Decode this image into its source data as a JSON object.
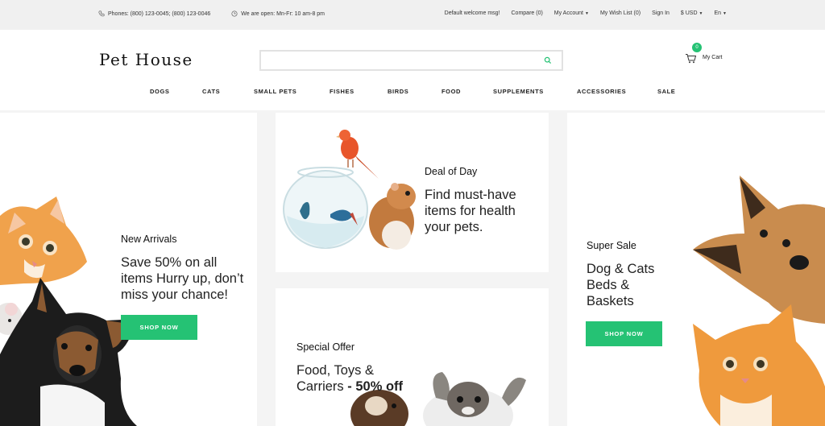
{
  "topbar": {
    "phones": "Phones: (800) 123-0045; (800) 123-0046",
    "hours": "We are open: Mn-Fr: 10 am-8 pm",
    "welcome": "Default welcome msg!",
    "compare": "Compare (0)",
    "my_account": "My Account",
    "wishlist": "My Wish List (0)",
    "sign_in": "Sign In",
    "currency": "$ USD",
    "language": "En"
  },
  "header": {
    "logo": "Pet House",
    "search_placeholder": "",
    "cart_count": "0",
    "cart_label": "My Cart"
  },
  "nav": [
    "DOGS",
    "CATS",
    "SMALL PETS",
    "FISHES",
    "BIRDS",
    "FOOD",
    "SUPPLEMENTS",
    "ACCESSORIES",
    "SALE"
  ],
  "banners": {
    "new_arrivals": {
      "eyebrow": "New Arrivals",
      "headline_1": "Save 50% on all",
      "headline_2": "items Hurry up, don’t",
      "headline_3": "miss your chance!",
      "button": "SHOP NOW"
    },
    "deal": {
      "eyebrow": "Deal of Day",
      "headline_1": "Find must-have",
      "headline_2": "items for health",
      "headline_3": "your pets."
    },
    "special": {
      "eyebrow": "Special Offer",
      "headline_1": "Food, Toys &",
      "headline_2": "Carriers",
      "headline_off": " - 50% off"
    },
    "super_sale": {
      "eyebrow": "Super Sale",
      "headline_1": "Dog & Cats",
      "headline_2": "Beds &",
      "headline_3": "Baskets",
      "button": "SHOP NOW"
    }
  },
  "colors": {
    "accent": "#25c274",
    "topbar_bg": "#f0f0f0",
    "page_bg": "#f4f4f4"
  }
}
